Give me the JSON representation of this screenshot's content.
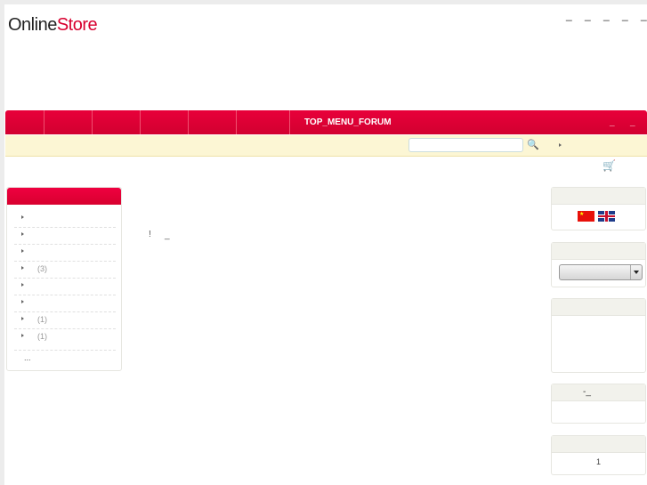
{
  "header": {
    "logo_dark": "Online",
    "logo_red": "Store",
    "top_links": [
      "_",
      "_",
      "_",
      "_",
      "_"
    ]
  },
  "nav": {
    "forum": "TOP_MENU_FORUM",
    "right": [
      "_",
      "_"
    ]
  },
  "search": {
    "value": "",
    "placeholder": ""
  },
  "categories": {
    "items": [
      {
        "count": ""
      },
      {
        "count": ""
      },
      {
        "count": ""
      },
      {
        "count": "(3)"
      },
      {
        "count": ""
      },
      {
        "count": ""
      },
      {
        "count": "(1)"
      },
      {
        "count": "(1)"
      }
    ],
    "more": "..."
  },
  "main": {
    "text1": "!",
    "text2": "_"
  },
  "right": {
    "box4_title": "-_",
    "box5_value": "1"
  }
}
